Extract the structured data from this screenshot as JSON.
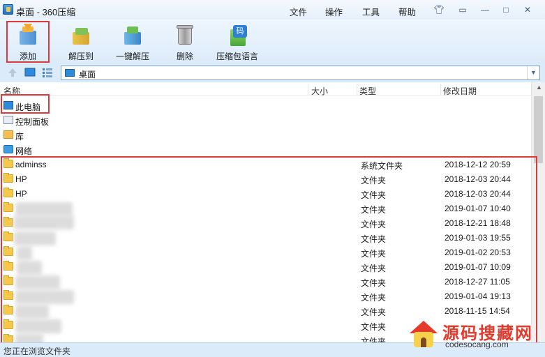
{
  "window": {
    "title": "桌面 - 360压缩",
    "menu": [
      "文件",
      "操作",
      "工具",
      "帮助"
    ],
    "title_icons": [
      "skin-icon",
      "feedback-icon",
      "minimize-icon",
      "maximize-icon",
      "close-icon"
    ]
  },
  "toolbar": {
    "buttons": [
      {
        "label": "添加",
        "icon": "add-archive-icon"
      },
      {
        "label": "解压到",
        "icon": "extract-to-icon"
      },
      {
        "label": "一键解压",
        "icon": "one-click-extract-icon"
      },
      {
        "label": "删除",
        "icon": "trash-icon"
      },
      {
        "label": "压缩包语言",
        "icon": "archive-language-icon"
      }
    ]
  },
  "address": {
    "path": "桌面"
  },
  "list": {
    "columns": [
      "名称",
      "大小",
      "类型",
      "修改日期"
    ],
    "special_items": [
      {
        "name": "此电脑",
        "icon": "computer-icon"
      },
      {
        "name": "控制面板",
        "icon": "control-panel-icon"
      },
      {
        "name": "库",
        "icon": "library-icon"
      },
      {
        "name": "网络",
        "icon": "network-icon"
      }
    ],
    "files": [
      {
        "name": "adminss",
        "type": "系统文件夹",
        "date": "2018-12-12 20:59"
      },
      {
        "name": "HP",
        "type": "文件夹",
        "date": "2018-12-03 20:44"
      },
      {
        "name": "HP",
        "type": "文件夹",
        "date": "2018-12-03 20:44"
      },
      {
        "name": "",
        "type": "文件夹",
        "date": "2019-01-07 10:40"
      },
      {
        "name": "",
        "type": "文件夹",
        "date": "2018-12-21 18:48"
      },
      {
        "name": "",
        "type": "文件夹",
        "date": "2019-01-03 19:55"
      },
      {
        "name": "",
        "type": "文件夹",
        "date": "2019-01-02 20:53"
      },
      {
        "name": "",
        "type": "文件夹",
        "date": "2019-01-07 10:09"
      },
      {
        "name": "",
        "type": "文件夹",
        "date": "2018-12-27 11:05"
      },
      {
        "name": "",
        "type": "文件夹",
        "date": "2019-01-04 19:13"
      },
      {
        "name": "",
        "type": "文件夹",
        "date": "2018-11-15 14:54"
      },
      {
        "name": "",
        "type": "文件夹",
        "date": ""
      },
      {
        "name": "",
        "type": "文件夹",
        "date": ""
      }
    ]
  },
  "status": {
    "text": "您正在浏览文件夹"
  },
  "watermark": {
    "brand": "源码搜藏网",
    "url": "codesocang.com"
  },
  "colors": {
    "highlight_border": "#d93a3a",
    "toolbar_bg": "#dcebfa",
    "folder": "#f5c94c"
  }
}
